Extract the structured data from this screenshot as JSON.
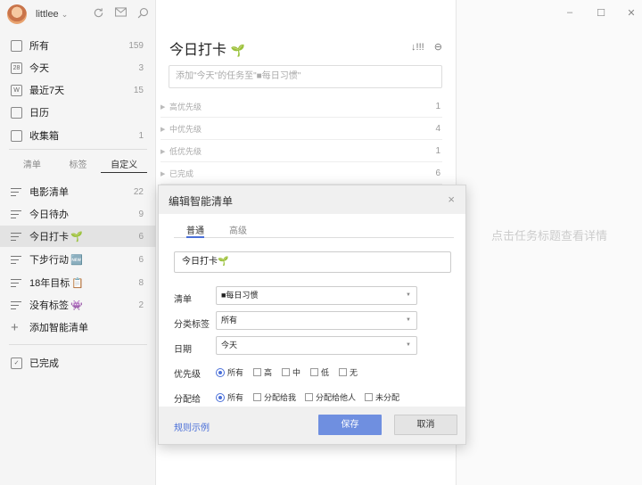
{
  "user": {
    "name": "littlee",
    "chevron": "⌄"
  },
  "toolbar": {
    "sync_icon": "sync-icon",
    "mail_icon": "mail-icon",
    "search_icon": "search-icon"
  },
  "window": {
    "minimize": "–",
    "maximize": "☐",
    "close": "✕"
  },
  "sidebar": {
    "system": [
      {
        "label": "所有",
        "count": "159",
        "icon": "inbox-icon"
      },
      {
        "label": "今天",
        "count": "3",
        "icon": "calendar-28-icon",
        "glyph": "28"
      },
      {
        "label": "最近7天",
        "count": "15",
        "icon": "week-icon",
        "glyph": "W"
      },
      {
        "label": "日历",
        "count": "",
        "icon": "calendar-icon",
        "glyph": ""
      },
      {
        "label": "收集箱",
        "count": "1",
        "icon": "collect-icon",
        "glyph": ""
      }
    ],
    "tabs": [
      "清单",
      "标签",
      "自定义"
    ],
    "custom": [
      {
        "label": "电影清单",
        "emoji": "",
        "count": "22"
      },
      {
        "label": "今日待办",
        "emoji": "",
        "count": "9"
      },
      {
        "label": "今日打卡",
        "emoji": "🌱",
        "count": "6"
      },
      {
        "label": "下步行动",
        "emoji": "🆕",
        "count": "6"
      },
      {
        "label": "18年目标",
        "emoji": "📋",
        "count": "8"
      },
      {
        "label": "没有标签",
        "emoji": "👾",
        "count": "2"
      }
    ],
    "add_label": "添加智能清单",
    "completed_label": "已完成"
  },
  "middle": {
    "title": "今日打卡",
    "title_emoji": "🌱",
    "sort_icon_text": "↓!!!",
    "more_icon_text": "⊖",
    "add_placeholder": "添加\"今天\"的任务至\"■每日习惯\"",
    "groups": [
      {
        "label": "高优先级",
        "count": "1"
      },
      {
        "label": "中优先级",
        "count": "4"
      },
      {
        "label": "低优先级",
        "count": "1"
      },
      {
        "label": "已完成",
        "count": "6"
      }
    ]
  },
  "right": {
    "empty_hint": "点击任务标题查看详情"
  },
  "dialog": {
    "title": "编辑智能清单",
    "close": "×",
    "tabs": [
      "普通",
      "高级"
    ],
    "name_value": "今日打卡🌱",
    "fields": {
      "list": {
        "label": "清单",
        "value": "■每日习惯"
      },
      "tags": {
        "label": "分类标签",
        "value": "所有"
      },
      "date": {
        "label": "日期",
        "value": "今天"
      }
    },
    "priority": {
      "label": "优先级",
      "options": [
        "所有",
        "高",
        "中",
        "低",
        "无"
      ]
    },
    "assign": {
      "label": "分配给",
      "options": [
        "所有",
        "分配给我",
        "分配给他人",
        "未分配"
      ]
    },
    "rule_link": "规则示例",
    "save": "保存",
    "cancel": "取消"
  }
}
